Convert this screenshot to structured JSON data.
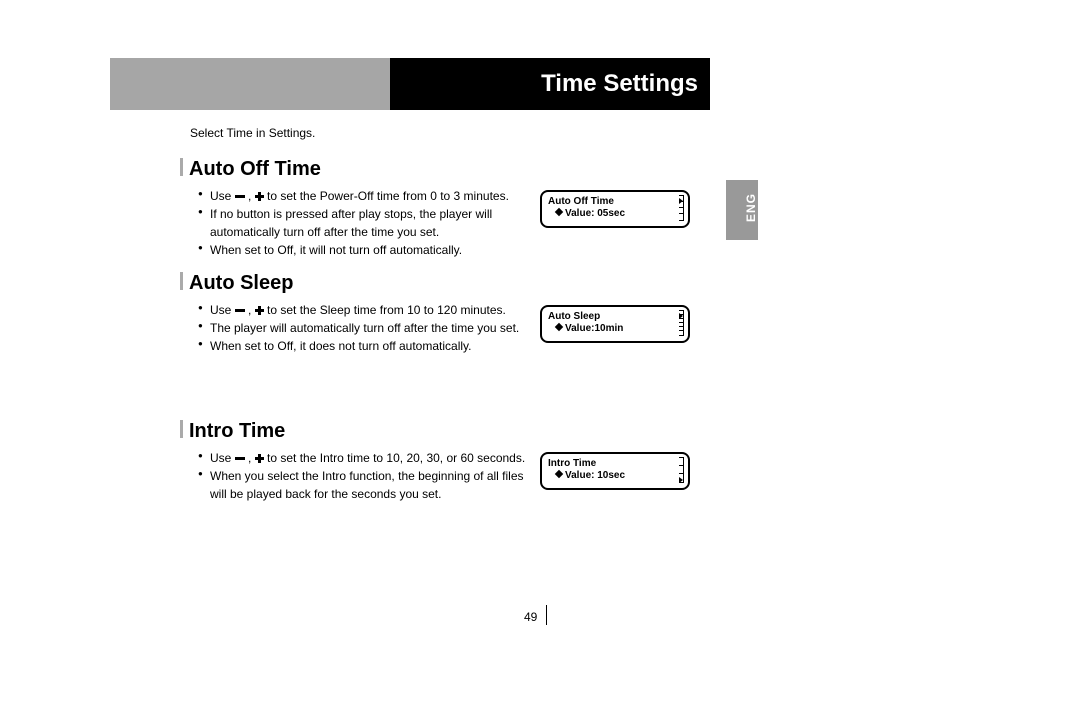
{
  "banner": {
    "title": "Time Settings"
  },
  "lead": "Select Time in Settings.",
  "lang_tab": "ENG",
  "sections": {
    "auto_off_time": {
      "title": "Auto Off Time",
      "b1a": "Use ",
      "b1b": " to set the Power-Off time from 0 to 3 minutes.",
      "b2": "If no button is pressed after play stops, the player will automatically turn off after the time you set.",
      "b3": "When set to Off, it will not turn off automatically.",
      "lcd": {
        "l1": "Auto Off Time",
        "l2": "Value: 05sec"
      }
    },
    "auto_sleep": {
      "title": "Auto Sleep",
      "b1a": "Use ",
      "b1b": " to set the Sleep time from 10 to 120 minutes.",
      "b2": "The player will automatically turn off after the time you set.",
      "b3": "When set to Off, it does not turn off automatically.",
      "lcd": {
        "l1": "Auto Sleep",
        "l2": "Value:10min"
      }
    },
    "intro_time": {
      "title": "Intro Time",
      "b1a": "Use ",
      "b1b": " to set the Intro time to 10, 20, 30, or 60 seconds.",
      "b2": "When you select the Intro function, the beginning of all files will be played back for the seconds you set.",
      "lcd": {
        "l1": "Intro Time",
        "l2": "Value: 10sec"
      }
    }
  },
  "page_number": "49"
}
